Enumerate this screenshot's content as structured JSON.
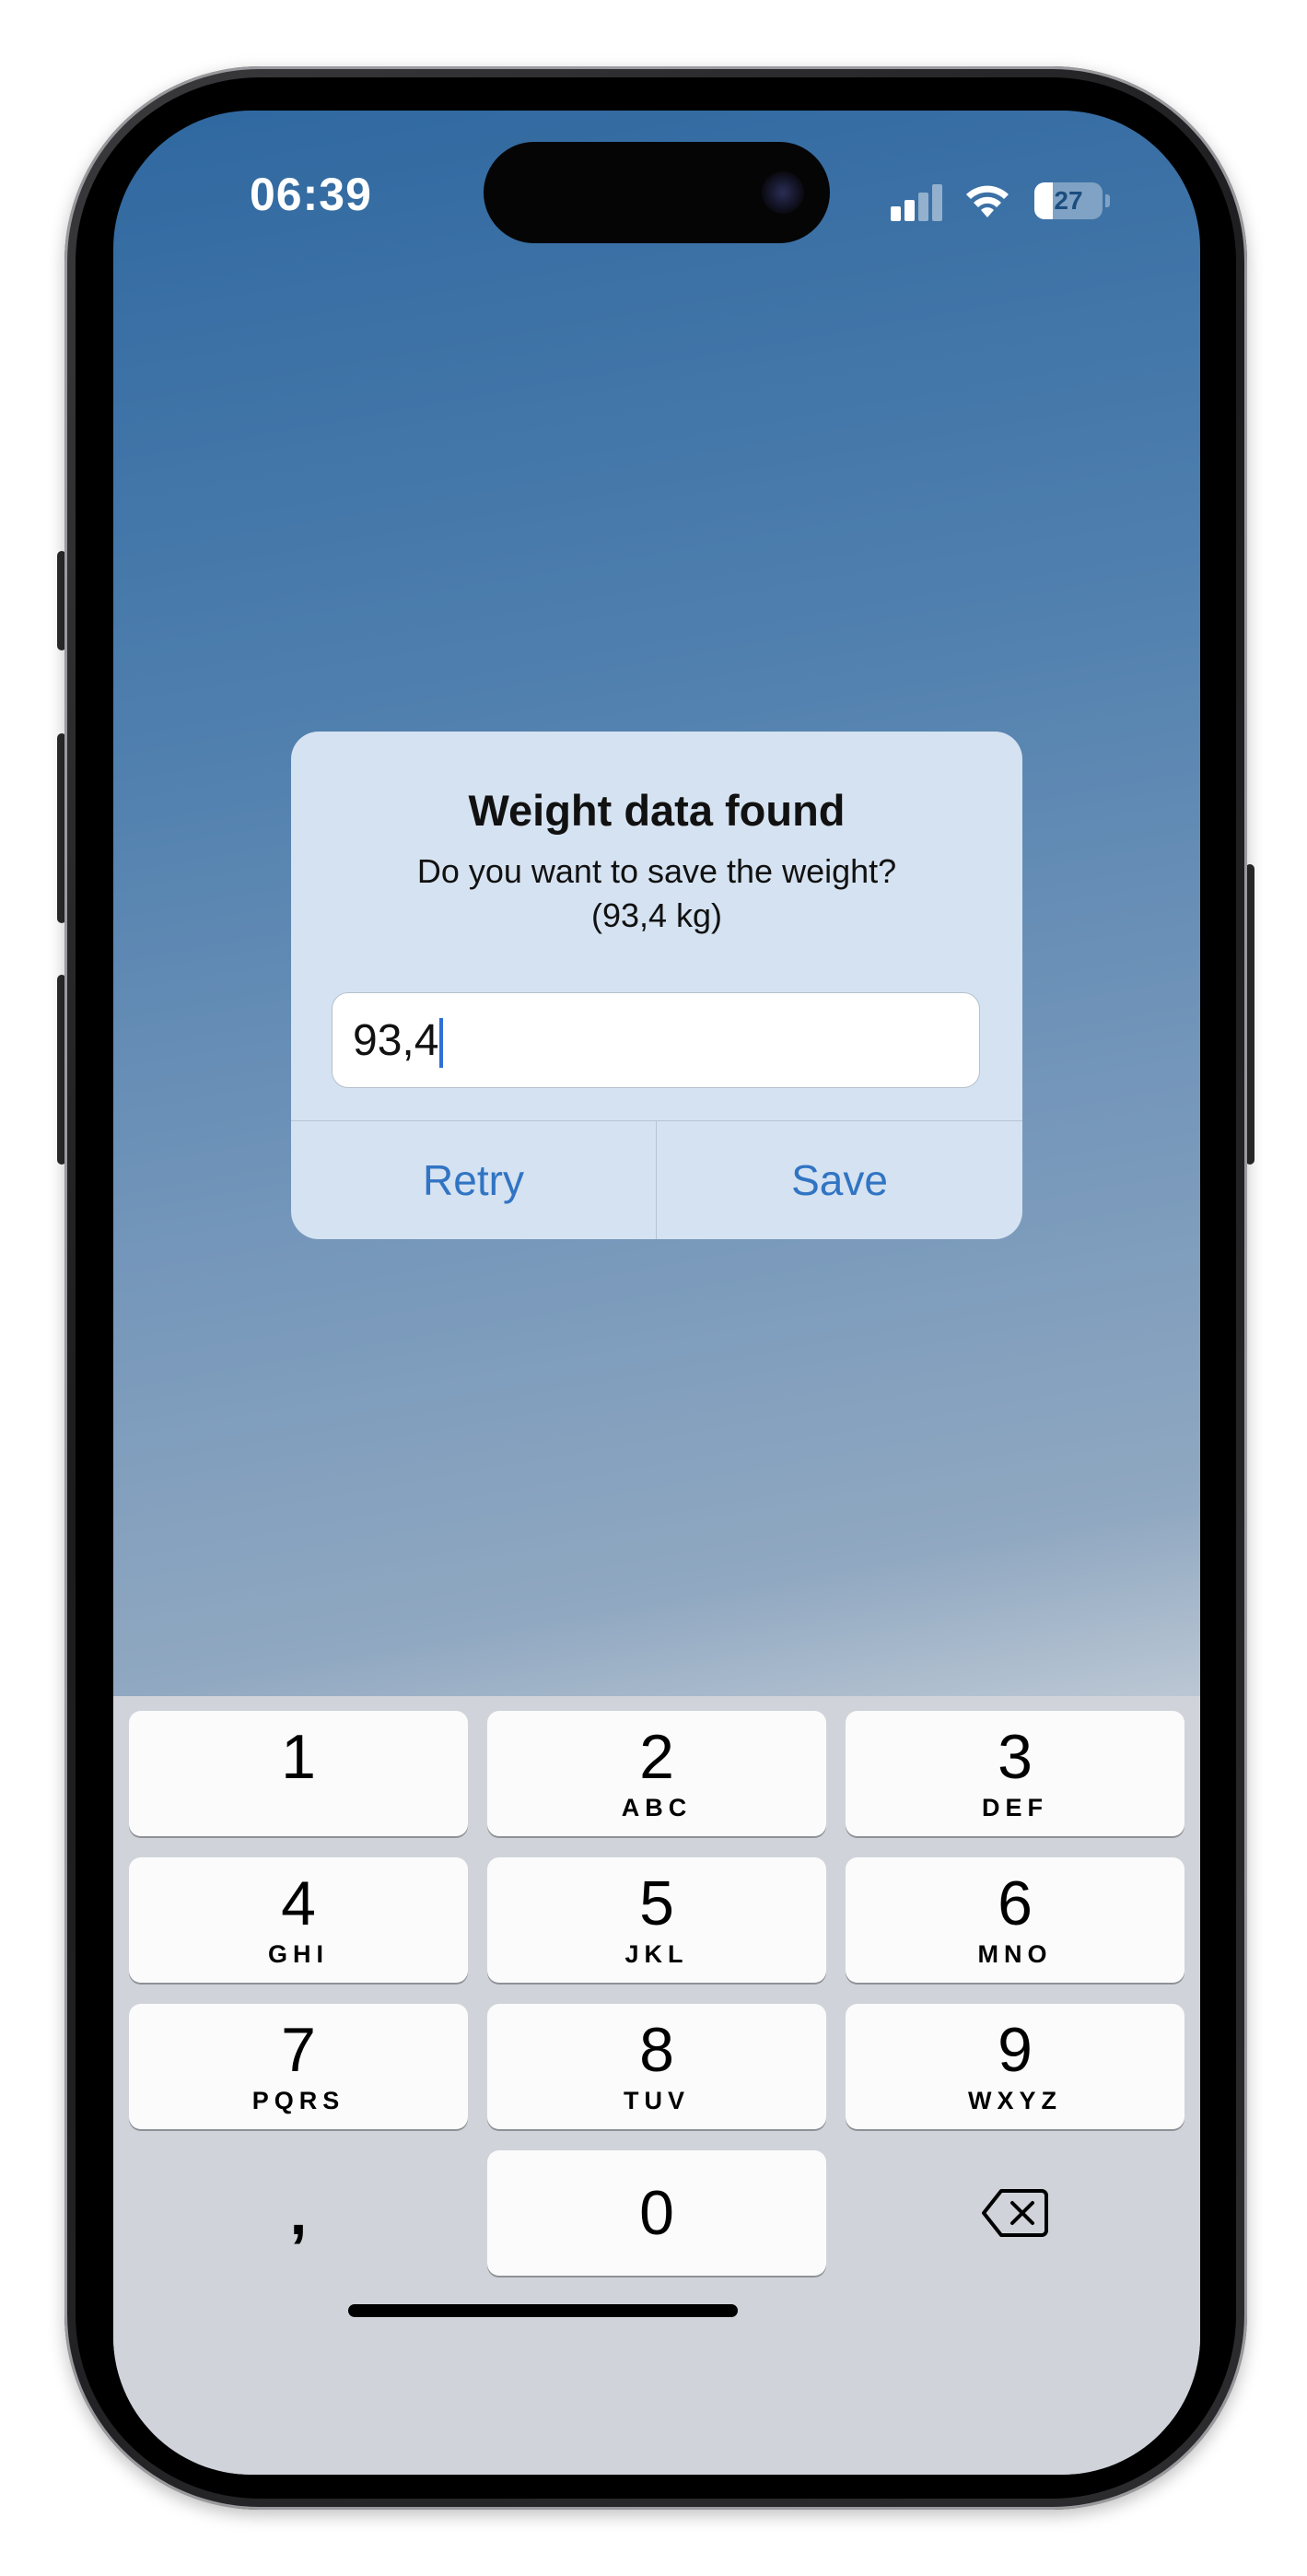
{
  "status_bar": {
    "time": "06:39",
    "battery_level": "27",
    "battery_fraction": 0.27
  },
  "alert": {
    "title": "Weight data found",
    "message_line1": "Do you want to save the weight?",
    "message_line2": "(93,4 kg)",
    "input_value": "93,4",
    "retry_label": "Retry",
    "save_label": "Save"
  },
  "keypad": {
    "keys": [
      {
        "digit": "1",
        "letters": ""
      },
      {
        "digit": "2",
        "letters": "ABC"
      },
      {
        "digit": "3",
        "letters": "DEF"
      },
      {
        "digit": "4",
        "letters": "GHI"
      },
      {
        "digit": "5",
        "letters": "JKL"
      },
      {
        "digit": "6",
        "letters": "MNO"
      },
      {
        "digit": "7",
        "letters": "PQRS"
      },
      {
        "digit": "8",
        "letters": "TUV"
      },
      {
        "digit": "9",
        "letters": "WXYZ"
      }
    ],
    "decimal_key": ",",
    "zero_key": "0",
    "delete_icon": "delete-left-icon"
  },
  "colors": {
    "accent": "#3174c3",
    "alert_background": "#d5e2f1",
    "keyboard_background": "#d0d4da"
  }
}
